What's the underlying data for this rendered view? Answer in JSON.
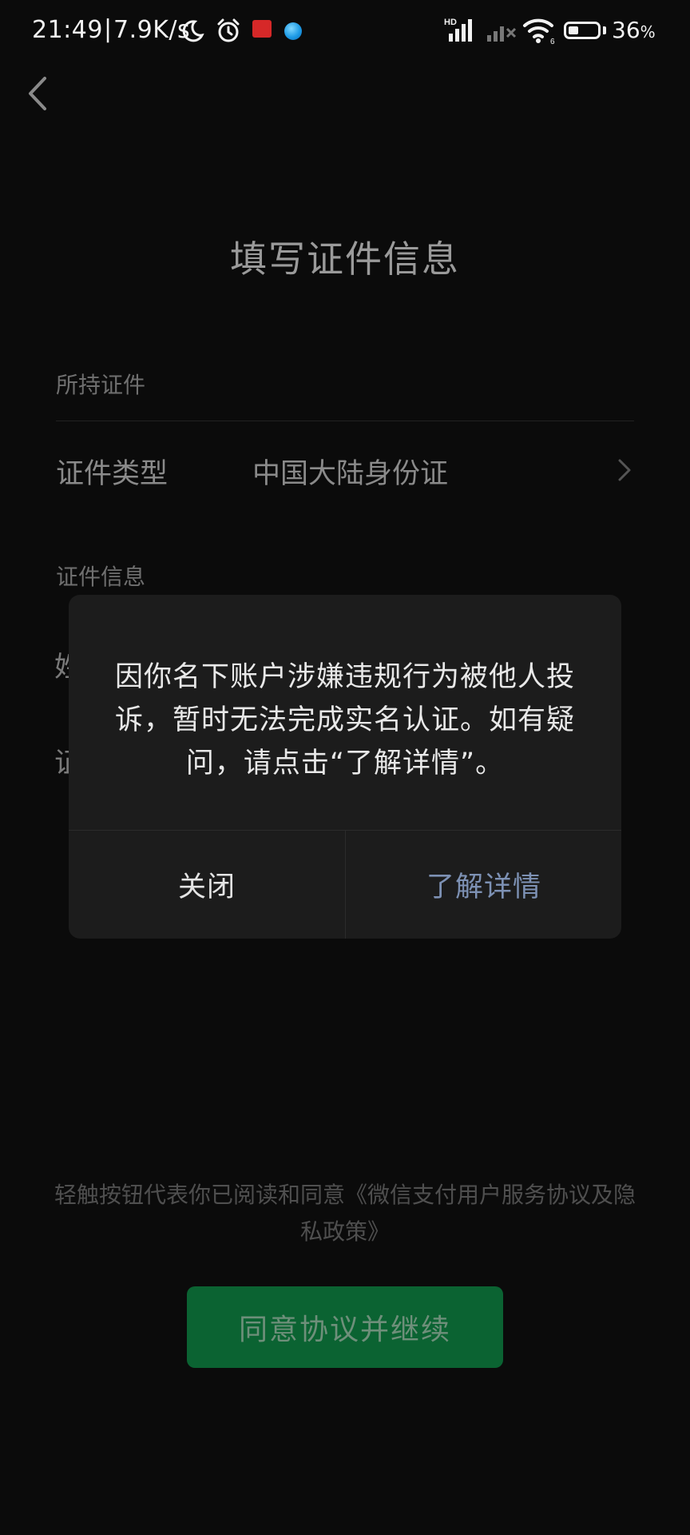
{
  "status_bar": {
    "time": "21:49",
    "separator": "|",
    "net_speed": "7.9K/s",
    "network_badge": "HD",
    "battery_percent": "36",
    "battery_unit": "%",
    "battery_level": 0.36,
    "icons": [
      "moon-icon",
      "alarm-icon",
      "app-notification-red-icon",
      "app-notification-blue-icon",
      "signal-hd-icon",
      "signal-no-sim-icon",
      "wifi-6-icon",
      "battery-icon"
    ]
  },
  "header": {
    "back_icon": "chevron-left-icon",
    "title": "填写证件信息"
  },
  "form": {
    "section_held": "所持证件",
    "id_type_label": "证件类型",
    "id_type_value": "中国大陆身份证",
    "section_info": "证件信息",
    "peek_row_1": "姓",
    "peek_row_2": "证"
  },
  "dialog": {
    "message": "因你名下账户涉嫌违规行为被他人投诉，暂时无法完成实名认证。如有疑问，请点击“了解详情”。",
    "close_label": "关闭",
    "details_label": "了解详情"
  },
  "footer": {
    "agreement": "轻触按钮代表你已阅读和同意《微信支付用户服务协议及隐私政策》",
    "continue_label": "同意协议并继续"
  },
  "colors": {
    "background": "#0b0b0b",
    "dialog_bg": "#1c1c1c",
    "link_blue": "#7d91b4",
    "wechat_green": "#0b6332"
  }
}
